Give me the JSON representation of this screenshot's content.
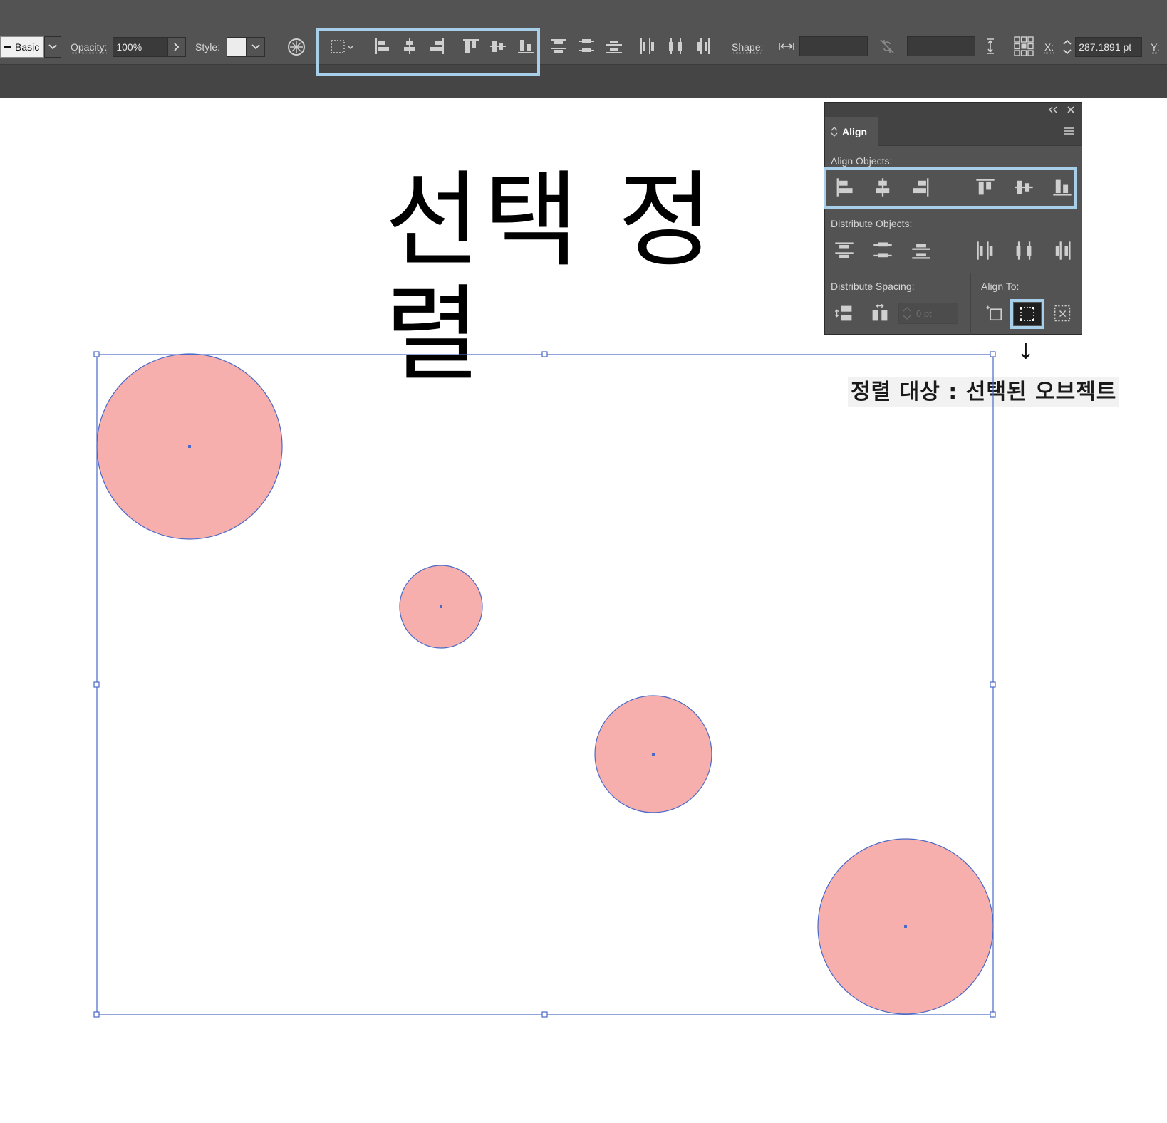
{
  "control_bar": {
    "stroke_profile": "Basic",
    "opacity_label": "Opacity:",
    "opacity_value": "100%",
    "style_label": "Style:",
    "shape_label": "Shape:",
    "x_label": "X:",
    "x_value": "287.1891 pt",
    "y_label": "Y:"
  },
  "align_panel": {
    "tab_label": "Align",
    "align_objects_label": "Align Objects:",
    "distribute_objects_label": "Distribute Objects:",
    "distribute_spacing_label": "Distribute Spacing:",
    "spacing_value": "0 pt",
    "align_to_label": "Align To:",
    "align_to_selected": "align-to-selection"
  },
  "canvas": {
    "heading": "선택 정렬",
    "caption": "정렬 대상 : 선택된 오브젝트",
    "arrow": "↓"
  },
  "colors": {
    "highlight": "#a7cfe9",
    "circle_fill": "#f7afae",
    "selection": "#4b69c7",
    "ui_bg": "#535353"
  }
}
